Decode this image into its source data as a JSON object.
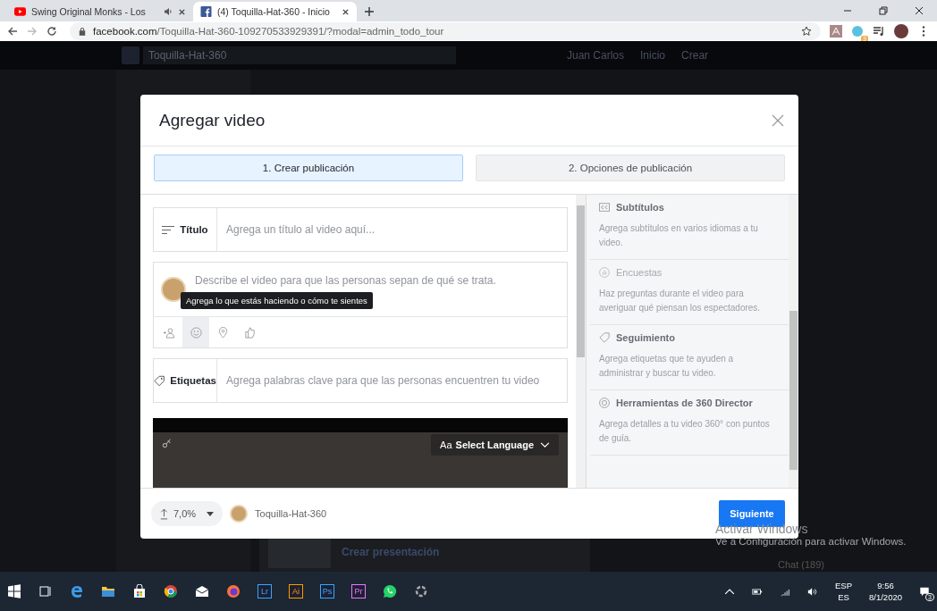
{
  "browser": {
    "tabs": [
      {
        "title": "Swing Original Monks - Los",
        "selected": false,
        "audio": true
      },
      {
        "title": "(4) Toquilla-Hat-360 - Inicio",
        "selected": true,
        "audio": false
      }
    ],
    "url_host": "facebook.com",
    "url_path": "/Toquilla-Hat-360-109270533929391/?modal=admin_todo_tour",
    "extension_badge": "3"
  },
  "page": {
    "search_value": "Toquilla-Hat-360",
    "nav": [
      "Juan Carlos",
      "Inicio",
      "Crear"
    ],
    "card_title": "Crear presentación",
    "chat": "Chat (189)"
  },
  "modal": {
    "title": "Agregar video",
    "steps": [
      {
        "label": "1. Crear publicación",
        "selected": true
      },
      {
        "label": "2. Opciones de publicación",
        "selected": false
      }
    ],
    "title_field": {
      "label": "Título",
      "placeholder": "Agrega un título al video aquí..."
    },
    "description": {
      "placeholder": "Describe el video para que las personas sepan de qué se trata.",
      "tooltip": "Agrega lo que estás haciendo o cómo te sientes"
    },
    "composer_tools": [
      {
        "selected": false
      },
      {
        "selected": true
      },
      {
        "selected": false
      },
      {
        "selected": false
      }
    ],
    "tags_field": {
      "label": "Etiquetas",
      "placeholder": "Agrega palabras clave para que las personas encuentren tu video"
    },
    "preview": {
      "language_button": "Select Language",
      "language_prefix": "Aa"
    },
    "options": [
      {
        "title": "Subtítulos",
        "description": "Agrega subtítulos en varios idiomas a tu video.",
        "disabled": false
      },
      {
        "title": "Encuestas",
        "description": "Haz preguntas durante el video para averiguar qué piensan los espectadores.",
        "disabled": true
      },
      {
        "title": "Seguimiento",
        "description": "Agrega etiquetas que te ayuden a administrar y buscar tu video.",
        "disabled": false
      },
      {
        "title": "Herramientas de 360 Director",
        "description": "Agrega detalles a tu video 360° con puntos de guía.",
        "disabled": false
      }
    ],
    "upload_percent": "7,0%",
    "page_name": "Toquilla-Hat-360",
    "next_button": "Siguiente"
  },
  "activation": {
    "title": "Activar Windows",
    "text": "Ve a Configuración para activar Windows."
  },
  "taskbar": {
    "lettered_apps": [
      {
        "label": "Lr",
        "color": "#31a8ff"
      },
      {
        "label": "Ai",
        "color": "#ff9a00"
      },
      {
        "label": "Ps",
        "color": "#31a8ff"
      },
      {
        "label": "Pr",
        "color": "#ea77ff"
      }
    ],
    "language": "ESP",
    "layout": "ES",
    "time": "9:56",
    "date": "8/1/2020",
    "notifications": "3"
  }
}
